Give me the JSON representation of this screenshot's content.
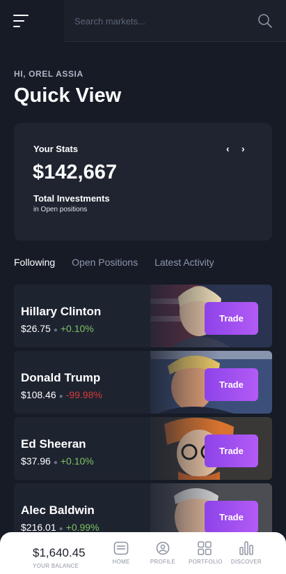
{
  "search": {
    "placeholder": "Search markets..."
  },
  "greeting": "HI, OREL ASSIA",
  "page_title": "Quick View",
  "stats": {
    "title": "Your Stats",
    "value": "$142,667",
    "label": "Total Investments",
    "sublabel": "in Open positions"
  },
  "tabs": [
    {
      "label": "Following",
      "active": true
    },
    {
      "label": "Open Positions",
      "active": false
    },
    {
      "label": "Latest Activity",
      "active": false
    }
  ],
  "markets": [
    {
      "name": "Hillary Clinton",
      "price": "$26.75",
      "change": "+0.10%",
      "direction": "up",
      "trade_label": "Trade"
    },
    {
      "name": "Donald Trump",
      "price": "$108.46",
      "change": "-99.98%",
      "direction": "down",
      "trade_label": "Trade"
    },
    {
      "name": "Ed Sheeran",
      "price": "$37.96",
      "change": "+0.10%",
      "direction": "up",
      "trade_label": "Trade"
    },
    {
      "name": "Alec Baldwin",
      "price": "$216.01",
      "change": "+0.99%",
      "direction": "up",
      "trade_label": "Trade"
    }
  ],
  "bottom_bar": {
    "balance": "$1,640.45",
    "balance_label": "YOUR BALANCE",
    "nav": [
      {
        "label": "HOME",
        "icon": "home-icon"
      },
      {
        "label": "PROFILE",
        "icon": "profile-icon"
      },
      {
        "label": "PORTFOLIO",
        "icon": "portfolio-icon"
      },
      {
        "label": "DISCOVER",
        "icon": "discover-icon"
      }
    ]
  },
  "colors": {
    "background": "#161b26",
    "card": "#1f2430",
    "accent": "#9b4ff0",
    "positive": "#7cc35f",
    "negative": "#d83a3a"
  }
}
